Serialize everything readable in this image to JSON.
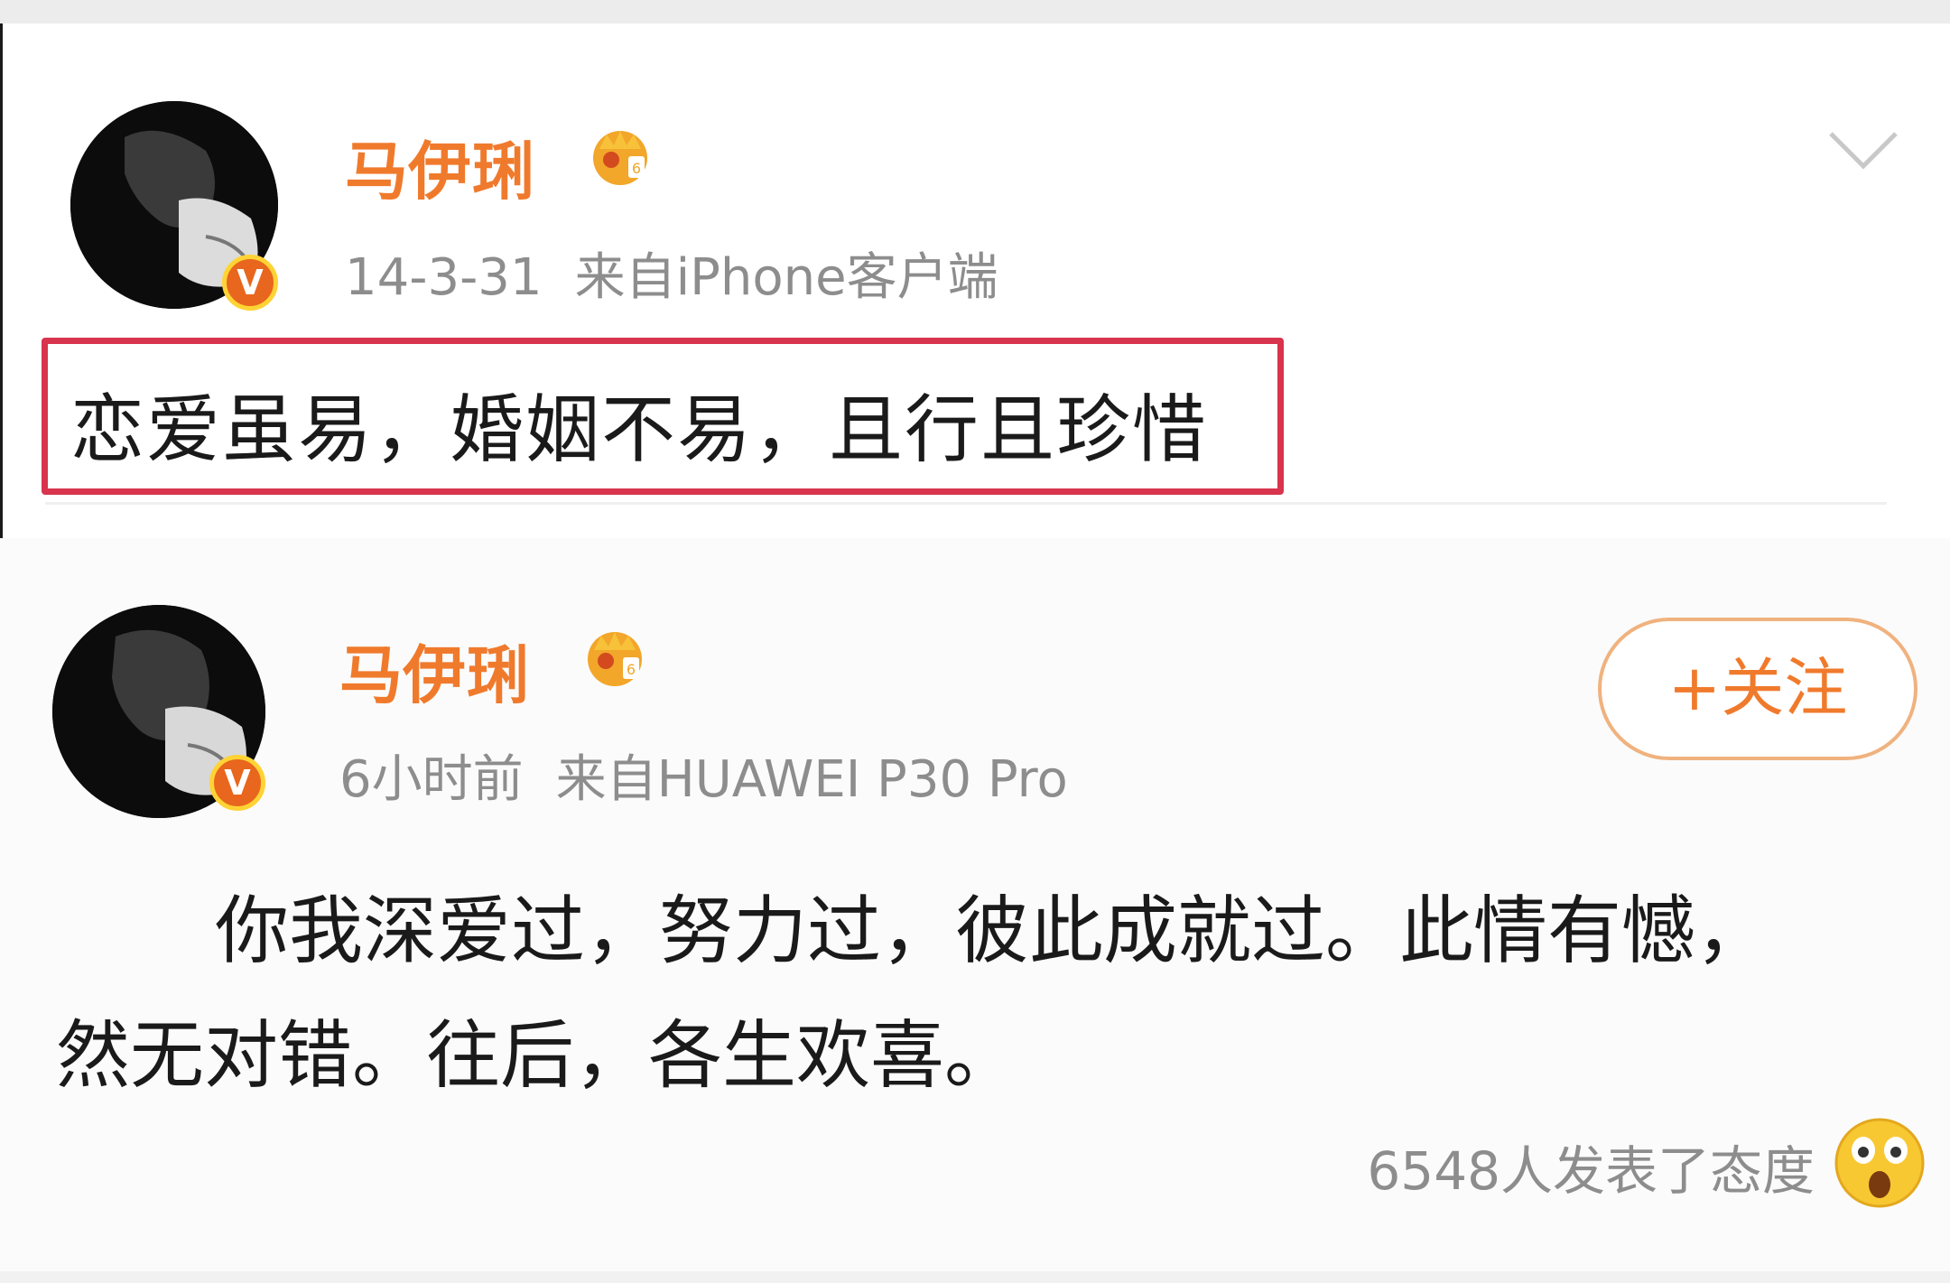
{
  "post1": {
    "username": "马伊琍",
    "date": "14-3-31",
    "device": "来自iPhone客户端",
    "text": "恋爱虽易，婚姻不易，且行且珍惜"
  },
  "post2": {
    "username": "马伊琍",
    "time": "6小时前",
    "device": "来自HUAWEI P30 Pro",
    "follow_label": "+关注",
    "text_line1": "你我深爱过，努力过，彼此成就过。此情有憾，",
    "text_line2": "然无对错。往后，各生欢喜。",
    "reactions": "6548人发表了态度"
  },
  "badges": {
    "verified": "V"
  },
  "icons": [
    "avatar",
    "verified-v-badge",
    "vip-crown-icon",
    "chevron-down-icon",
    "surprised-emoji-icon"
  ],
  "colors": {
    "username": "#f07a2c",
    "highlight_box": "#d8344d",
    "meta": "#8d8d8d"
  }
}
